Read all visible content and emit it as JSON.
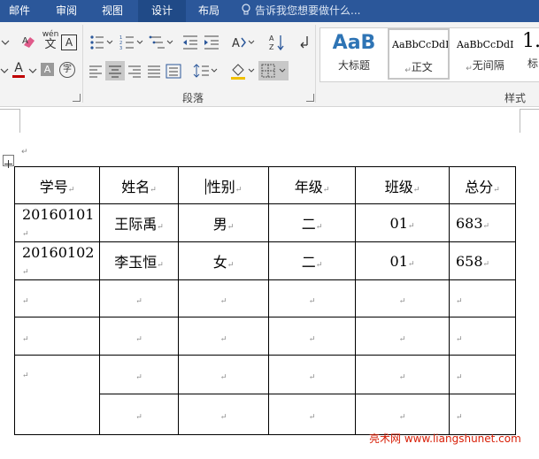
{
  "tabs": [
    {
      "label": "邮件"
    },
    {
      "label": "审阅"
    },
    {
      "label": "视图"
    },
    {
      "label": "设计"
    },
    {
      "label": "布局"
    }
  ],
  "tellme": {
    "text": "告诉我您想要做什么..."
  },
  "ribbon": {
    "paragraph_group_label": "段落",
    "styles_group_label": "样式",
    "phonetic_label": "wén",
    "phonetic_glyph": "文",
    "bordered_glyph": "A",
    "enclosed_glyph": "字",
    "font_color_glyph": "A",
    "font_color": "#c00000",
    "styles": [
      {
        "preview": "AaB",
        "name": "大标题"
      },
      {
        "preview": "AaBbCcDdI",
        "name": "正文"
      },
      {
        "preview": "AaBbCcDdI",
        "name": "无间隔"
      },
      {
        "preview": "1.",
        "name": "标"
      }
    ]
  },
  "table": {
    "rows": [
      [
        "学号",
        "姓名",
        "性别",
        "年级",
        "班级",
        "总分"
      ],
      [
        "20160101",
        "王际禹",
        "男",
        "二",
        "01",
        "683"
      ],
      [
        "20160102",
        "李玉恒",
        "女",
        "二",
        "01",
        "658"
      ],
      [
        "",
        "",
        "",
        "",
        "",
        ""
      ],
      [
        "",
        "",
        "",
        "",
        "",
        ""
      ],
      [
        "",
        "",
        "",
        "",
        "",
        ""
      ],
      [
        "",
        "",
        "",
        "",
        "",
        ""
      ]
    ]
  },
  "paragraph_mark": "↵",
  "watermark": "亮术网 www.liangshunet.com",
  "colors": {
    "tab_bar": "#2b579a",
    "accent_red": "#d81e06"
  }
}
